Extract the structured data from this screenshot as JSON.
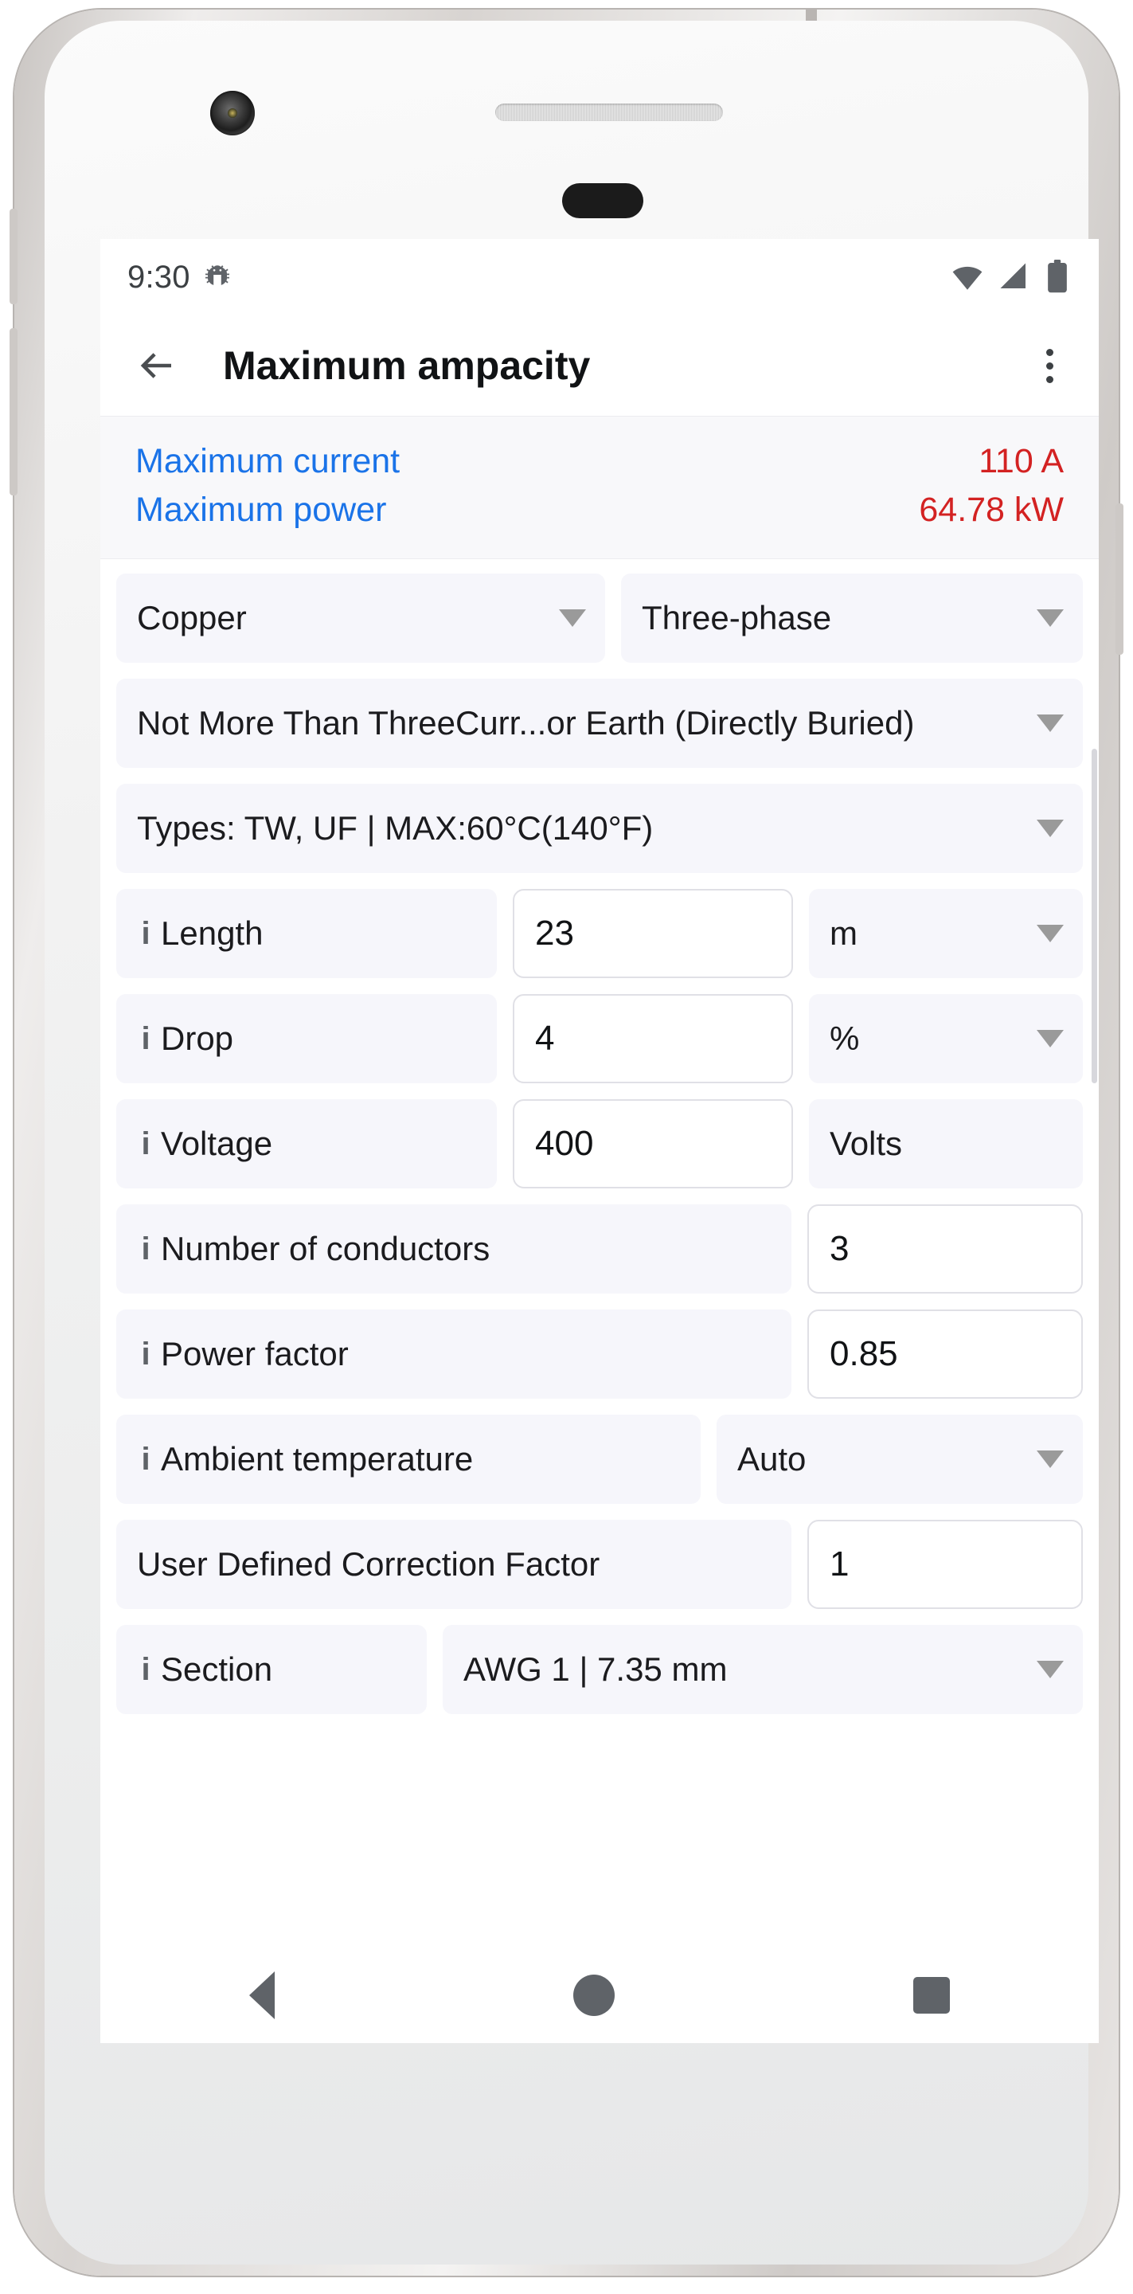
{
  "statusbar": {
    "time": "9:30",
    "icons": [
      "android-bug-icon",
      "wifi-icon",
      "cell-signal-icon",
      "battery-icon"
    ]
  },
  "appbar": {
    "back_label": "back-arrow",
    "title": "Maximum ampacity",
    "overflow_label": "more-options"
  },
  "results": {
    "rows": [
      {
        "label": "Maximum current",
        "value": "110 A"
      },
      {
        "label": "Maximum power",
        "value": "64.78 kW"
      }
    ],
    "label_color": "#1a73e8",
    "value_color": "#d32222"
  },
  "form": {
    "material": "Copper",
    "phase": "Three-phase",
    "installation": "Not More Than ThreeCurr...or Earth (Directly Buried)",
    "cable_type": "Types: TW, UF | MAX:60°C(140°F)",
    "length_label": "Length",
    "length_value": "23",
    "length_unit": "m",
    "drop_label": "Drop",
    "drop_value": "4",
    "drop_unit": "%",
    "voltage_label": "Voltage",
    "voltage_value": "400",
    "voltage_unit": "Volts",
    "conductors_label": "Number of conductors",
    "conductors_value": "3",
    "power_factor_label": "Power factor",
    "power_factor_value": "0.85",
    "ambient_label": "Ambient temperature",
    "ambient_value": "Auto",
    "correction_label": "User Defined Correction Factor",
    "correction_value": "1",
    "section_label": "Section",
    "section_value": "AWG 1 | 7.35 mm",
    "info_icon": "i"
  },
  "navbar": {
    "back": "nav-back-triangle",
    "home": "nav-home-circle",
    "recents": "nav-recents-square"
  }
}
